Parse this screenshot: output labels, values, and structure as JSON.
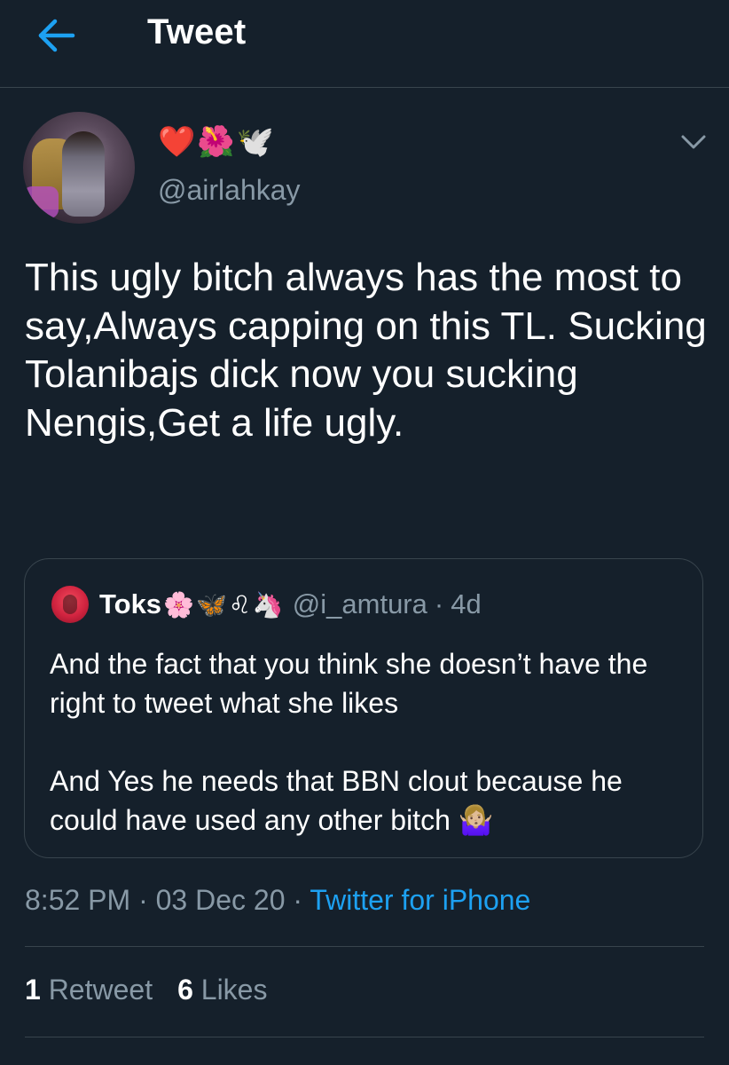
{
  "header": {
    "title": "Tweet",
    "back_icon": "arrow-left-icon",
    "accent_color": "#1da1f2"
  },
  "tweet": {
    "display_name_emojis": [
      "❤️",
      "🌺",
      "🕊️"
    ],
    "handle": "@airlahkay",
    "text": "This ugly bitch always has the most to say,Always capping on this TL. Sucking Tolanibajs dick now you sucking Nengis,Get a life ugly.",
    "menu_icon": "chevron-down-icon"
  },
  "quoted_tweet": {
    "name": "Toks",
    "name_emojis": [
      "🌸",
      "🦋",
      "♌",
      "🦄"
    ],
    "handle": "@i_amtura",
    "separator": "·",
    "time": "4d",
    "paragraph_1": "And the fact that you think she doesn’t have the right to tweet what she likes",
    "paragraph_2": "And Yes he needs that BBN clout because he could have used any other bitch 🤷🏼‍♀️"
  },
  "meta": {
    "time": "8:52 PM",
    "separator": "·",
    "date": "03 Dec 20",
    "source": "Twitter for iPhone"
  },
  "stats": {
    "retweets_count": "1",
    "retweets_label": "Retweet",
    "likes_count": "6",
    "likes_label": "Likes"
  },
  "colors": {
    "background": "#15202b",
    "border": "#38444d",
    "secondary_text": "#8899a6",
    "link": "#1da1f2"
  }
}
